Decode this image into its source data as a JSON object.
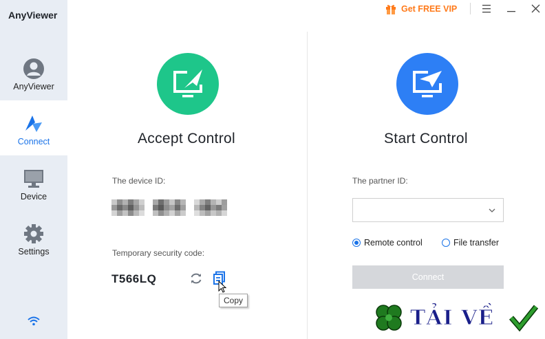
{
  "app": {
    "title": "AnyViewer"
  },
  "sidebar": {
    "items": [
      {
        "label": "AnyViewer",
        "icon": "avatar-icon"
      },
      {
        "label": "Connect",
        "icon": "connect-icon",
        "active": true
      },
      {
        "label": "Device",
        "icon": "monitor-icon"
      },
      {
        "label": "Settings",
        "icon": "gear-icon"
      }
    ],
    "status_icon": "wifi-icon"
  },
  "titlebar": {
    "vip_label": "Get FREE VIP",
    "menu_icon": "hamburger-icon",
    "minimize_icon": "minimize-icon",
    "close_icon": "close-icon"
  },
  "accept": {
    "title": "Accept Control",
    "device_id_label": "The device ID:",
    "device_id_value": "",
    "security_label": "Temporary security code:",
    "security_code": "T566LQ",
    "tooltip": "Copy"
  },
  "start": {
    "title": "Start Control",
    "partner_label": "The partner ID:",
    "partner_value": "",
    "options": [
      {
        "label": "Remote control",
        "checked": true
      },
      {
        "label": "File transfer",
        "checked": false
      }
    ],
    "connect_label": "Connect"
  },
  "watermark": {
    "text": "TẢI VỀ"
  },
  "colors": {
    "accent": "#1a73e8",
    "green": "#1ec68a",
    "blue": "#2d7ff5",
    "vip": "#ff7a1a",
    "sidebar_bg": "#e8edf4",
    "disabled_btn": "#d5d7db"
  }
}
